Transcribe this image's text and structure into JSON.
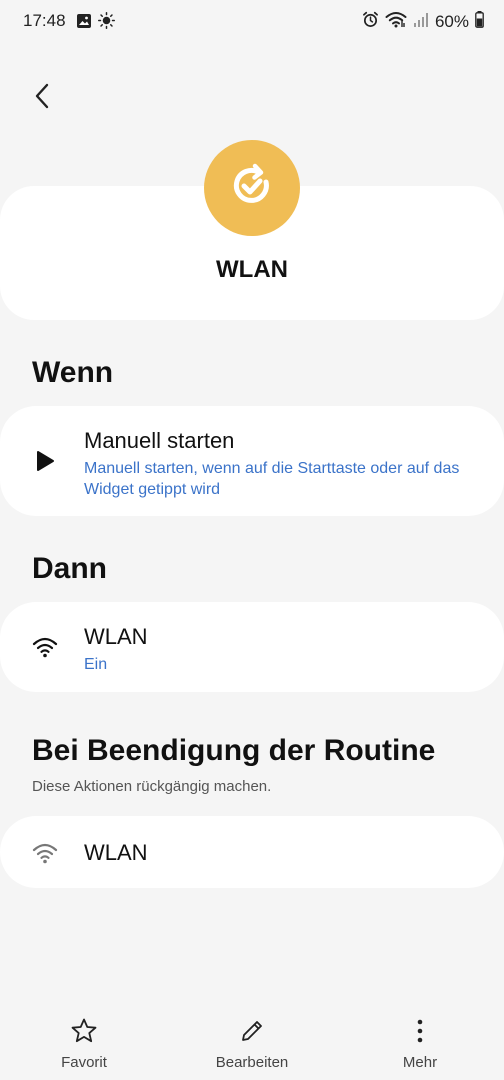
{
  "status_bar": {
    "time": "17:48",
    "battery": "60%",
    "left_icons": [
      "image-icon",
      "brightness-icon"
    ],
    "right_icons": [
      "alarm-icon",
      "wifi-icon",
      "signal-icon",
      "battery-icon"
    ]
  },
  "header": {
    "routine_name": "WLAN",
    "icon": "routine-check-icon",
    "icon_color": "#f0bd55"
  },
  "when": {
    "heading": "Wenn",
    "item": {
      "icon": "play-icon",
      "title": "Manuell starten",
      "description": "Manuell starten, wenn auf die Starttaste oder auf das Widget getippt wird"
    }
  },
  "then": {
    "heading": "Dann",
    "item": {
      "icon": "wifi-icon",
      "title": "WLAN",
      "value": "Ein"
    }
  },
  "on_end": {
    "heading": "Bei Beendigung der Routine",
    "subtitle": "Diese Aktionen rückgängig machen.",
    "item": {
      "icon": "wifi-icon",
      "title": "WLAN"
    }
  },
  "bottom_nav": {
    "favorite": "Favorit",
    "edit": "Bearbeiten",
    "more": "Mehr"
  },
  "colors": {
    "accent_link": "#3b73c9",
    "background": "#f5f5f5"
  }
}
